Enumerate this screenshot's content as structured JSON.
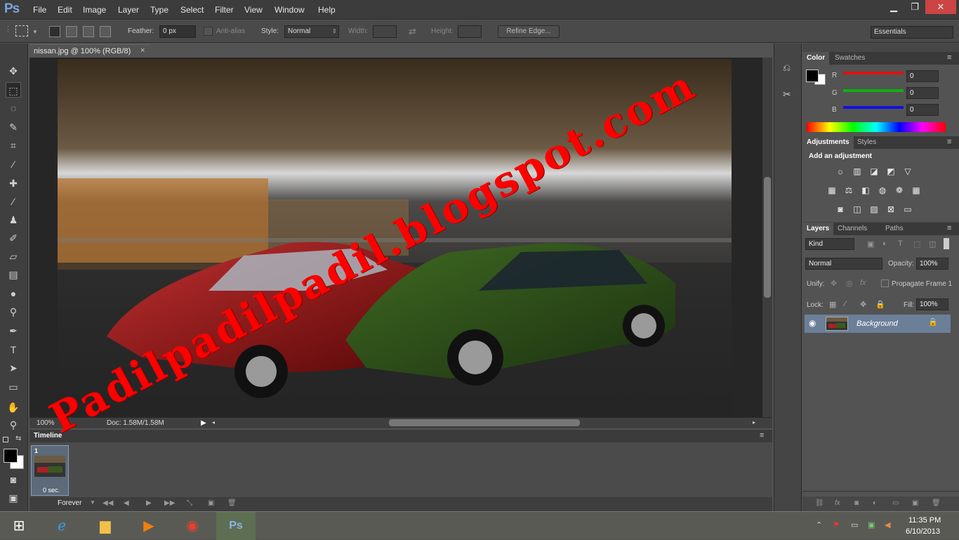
{
  "app": {
    "logo": "Ps"
  },
  "menu": [
    "File",
    "Edit",
    "Image",
    "Layer",
    "Type",
    "Select",
    "Filter",
    "View",
    "Window",
    "Help"
  ],
  "window_buttons": {
    "minimize": "▁",
    "restore": "❐",
    "close": "✕"
  },
  "options": {
    "feather_label": "Feather:",
    "feather_value": "0 px",
    "antialias_label": "Anti-alias",
    "style_label": "Style:",
    "style_value": "Normal",
    "width_label": "Width:",
    "height_label": "Height:",
    "refine_edge": "Refine Edge...",
    "workspace": "Essentials"
  },
  "document": {
    "tab_title": "nissan.jpg @ 100% (RGB/8)",
    "close": "×",
    "zoom": "100%",
    "doc_size": "Doc: 1.58M/1.58M"
  },
  "timeline": {
    "title": "Timeline",
    "frame_number": "1",
    "frame_delay": "0 sec.",
    "loop": "Forever"
  },
  "color_panel": {
    "tabs": [
      "Color",
      "Swatches"
    ],
    "r_label": "R",
    "g_label": "G",
    "b_label": "B",
    "r": "0",
    "g": "0",
    "b": "0",
    "colors": {
      "r": "#e01010",
      "g": "#10b010",
      "b": "#1010e0"
    }
  },
  "adjustments_panel": {
    "tabs": [
      "Adjustments",
      "Styles"
    ],
    "hint": "Add an adjustment"
  },
  "layers_panel": {
    "tabs": [
      "Layers",
      "Channels",
      "Paths"
    ],
    "filter": "Kind",
    "blend_mode": "Normal",
    "opacity_label": "Opacity:",
    "opacity": "100%",
    "unify_label": "Unify:",
    "propagate": "Propagate Frame 1",
    "lock_label": "Lock:",
    "fill_label": "Fill:",
    "fill": "100%",
    "layers": [
      {
        "name": "Background"
      }
    ]
  },
  "watermark": "Padilpadilpadil.blogspot.com",
  "taskbar": {
    "time": "11:35 PM",
    "date": "6/10/2013",
    "ps": "Ps"
  }
}
